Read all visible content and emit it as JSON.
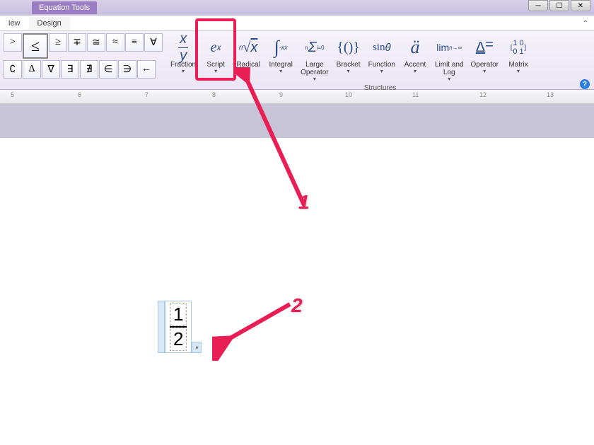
{
  "titlebar": {
    "contextTab": "Equation Tools"
  },
  "tabs": {
    "view": "iew",
    "design": "Design"
  },
  "symbols": {
    "row1": [
      ">",
      "≤",
      "≥",
      "∓",
      "≅",
      "≈",
      "≡",
      "∀"
    ],
    "row2": [
      "∁",
      "Δ",
      "∇",
      "∃",
      "∄",
      "∈",
      "∋",
      "←"
    ]
  },
  "structures": {
    "title": "Structures",
    "items": [
      {
        "label": "Fraction",
        "icon": "x/y"
      },
      {
        "label": "Script",
        "icon": "eˣ"
      },
      {
        "label": "Radical",
        "icon": "ⁿ√x"
      },
      {
        "label": "Integral",
        "icon": "∫"
      },
      {
        "label": "Large\nOperator",
        "icon": "Σ"
      },
      {
        "label": "Bracket",
        "icon": "{()}"
      },
      {
        "label": "Function",
        "icon": "sinθ"
      },
      {
        "label": "Accent",
        "icon": "ä"
      },
      {
        "label": "Limit and\nLog",
        "icon": "lim"
      },
      {
        "label": "Operator",
        "icon": "≜"
      },
      {
        "label": "Matrix",
        "icon": "[10;01]"
      }
    ]
  },
  "ruler": {
    "marks": [
      "5",
      "6",
      "7",
      "8",
      "9",
      "10",
      "11",
      "12",
      "13"
    ]
  },
  "equation": {
    "numerator": "1",
    "denominator": "2"
  },
  "annotations": {
    "label1": "1",
    "label2": "2"
  }
}
